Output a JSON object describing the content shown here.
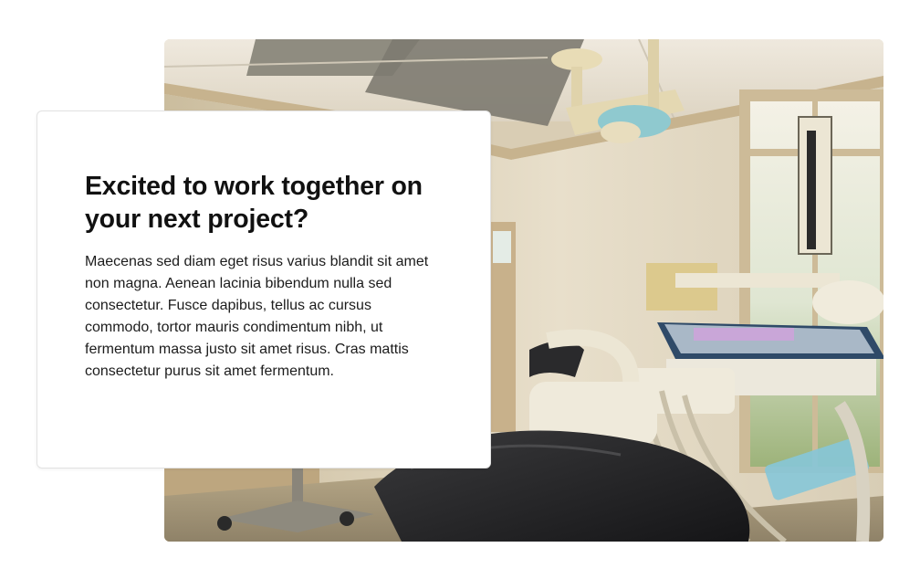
{
  "hero": {
    "image_alt": "Dental examination room with patient chair, overhead lamp and instrument tray",
    "heading": "Excited to work together on your next project?",
    "paragraph": "Maecenas sed diam eget risus varius blandit sit amet non magna. Aenean lacinia bibendum nulla sed consectetur. Fusce dapibus, tellus ac cursus commodo, tortor mauris condimentum nibh, ut fermentum massa justo sit amet risus. Cras mattis consectetur purus sit amet fermentum."
  },
  "colors": {
    "page_background": "#ffffff",
    "card_background": "#ffffff",
    "card_border": "#e2e2e2",
    "heading_text": "#111111",
    "body_text": "#1c1c1c"
  }
}
